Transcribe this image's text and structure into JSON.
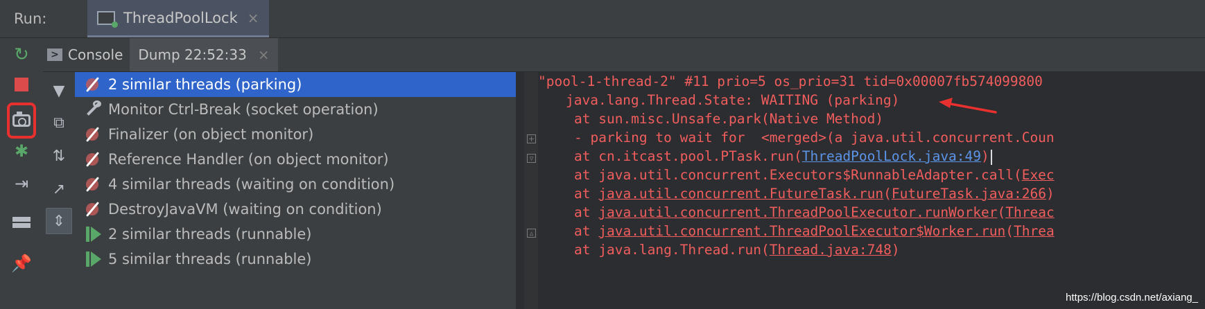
{
  "topbar": {
    "run_label": "Run:",
    "config_tab": "ThreadPoolLock",
    "close": "×"
  },
  "subtabs": {
    "console": "Console",
    "dump": "Dump 22:52:33",
    "close": "×"
  },
  "toolbar_icons": [
    "rerun-icon",
    "stop-icon",
    "dump-threads-icon",
    "debug-icon",
    "exit-icon",
    "layout-icon",
    "pin-icon"
  ],
  "side_tool_icons": [
    "filter-icon",
    "copy-icon",
    "sort-icon",
    "export-icon",
    "merge-icon"
  ],
  "threads": [
    {
      "label": "2 similar threads (parking)",
      "icon": "waiting",
      "selected": true
    },
    {
      "label": "Monitor Ctrl-Break (socket operation)",
      "icon": "wrench",
      "selected": false
    },
    {
      "label": "Finalizer (on object monitor)",
      "icon": "waiting",
      "selected": false
    },
    {
      "label": "Reference Handler (on object monitor)",
      "icon": "waiting",
      "selected": false
    },
    {
      "label": "4 similar threads (waiting on condition)",
      "icon": "waiting",
      "selected": false
    },
    {
      "label": "DestroyJavaVM (waiting on condition)",
      "icon": "waiting",
      "selected": false
    },
    {
      "label": "2 similar threads (runnable)",
      "icon": "running",
      "selected": false
    },
    {
      "label": "5 similar threads (runnable)",
      "icon": "running",
      "selected": false
    }
  ],
  "stack": {
    "header": "\"pool-1-thread-2\" #11 prio=5 os_prio=31 tid=0x00007fb574099800",
    "state": "java.lang.Thread.State: WAITING (parking)",
    "f1": "at sun.misc.Unsafe.park(Native Method)",
    "f2": "- parking to wait for  <merged>(a java.util.concurrent.Coun",
    "f3_pre": "at cn.itcast.pool.PTask.run(",
    "f3_link": "ThreadPoolLock.java:49",
    "f3_post": ")",
    "f4_pre": "at java.util.concurrent.Executors$RunnableAdapter.call(",
    "f4_link": "Exec",
    "f5_pre": "at ",
    "f5_cls": "java.util.concurrent.FutureTask.run",
    "f5_mid": "(",
    "f5_link": "FutureTask.java:266",
    "f5_post": ")",
    "f6_pre": "at ",
    "f6_cls": "java.util.concurrent.ThreadPoolExecutor.runWorker",
    "f6_mid": "(",
    "f6_link": "Threac",
    "f7_pre": "at ",
    "f7_cls": "java.util.concurrent.ThreadPoolExecutor$Worker.run",
    "f7_mid": "(",
    "f7_link": "Threa",
    "f8_pre": "at java.lang.Thread.run(",
    "f8_link": "Thread.java:748",
    "f8_post": ")"
  },
  "watermark": "https://blog.csdn.net/axiang_",
  "colors": {
    "selection": "#2f65ca",
    "stack_text": "#f25d5d",
    "link": "#5c94e8",
    "highlight": "#e8302f"
  }
}
